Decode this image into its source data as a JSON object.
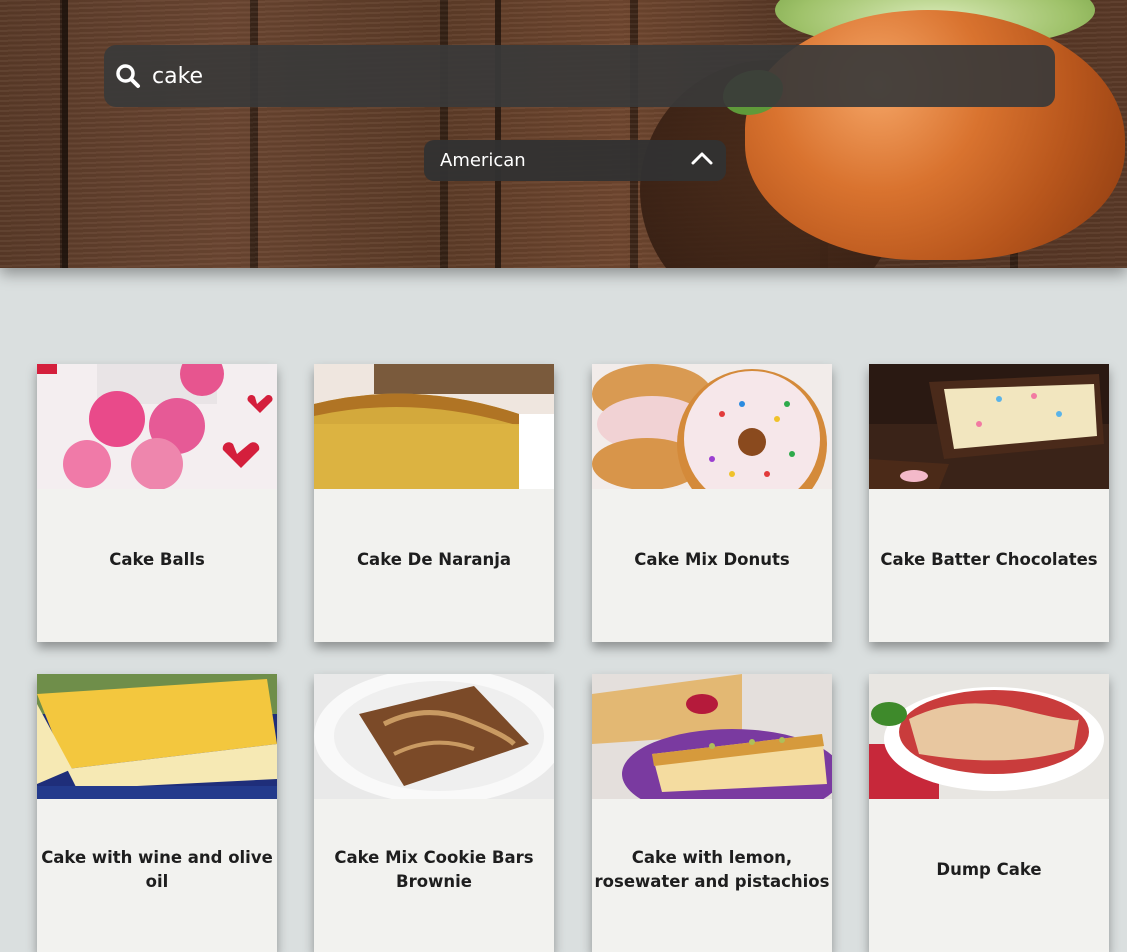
{
  "search": {
    "value": "cake",
    "placeholder": ""
  },
  "filter": {
    "selected": "American"
  },
  "recipes": [
    {
      "title": "Cake Balls"
    },
    {
      "title": "Cake De Naranja"
    },
    {
      "title": "Cake Mix Donuts"
    },
    {
      "title": "Cake Batter Chocolates"
    },
    {
      "title": "Cake with wine and olive oil"
    },
    {
      "title": "Cake Mix Cookie Bars Brownie"
    },
    {
      "title": "Cake with lemon, rosewater and pistachios"
    },
    {
      "title": "Dump Cake"
    }
  ],
  "icons": {
    "search": "search-icon",
    "dropdown": "chevron-up-icon"
  },
  "colors": {
    "background": "#dadfdf",
    "card": "#f2f2ef",
    "searchbar": "#3a3a3a"
  }
}
